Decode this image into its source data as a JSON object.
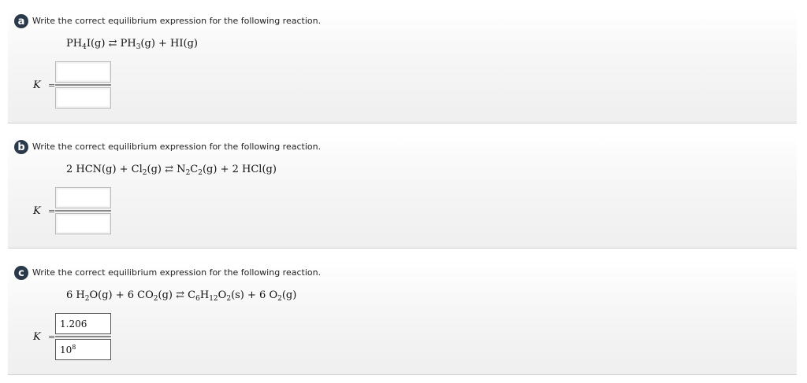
{
  "sections": [
    {
      "badge": "a",
      "prompt": "Write the correct equilibrium expression for the following reaction.",
      "k_label": "K",
      "equals": "=",
      "numerator": "",
      "denominator": ""
    },
    {
      "badge": "b",
      "prompt": "Write the correct equilibrium expression for the following reaction.",
      "k_label": "K",
      "equals": "=",
      "numerator": "",
      "denominator": ""
    },
    {
      "badge": "c",
      "prompt": "Write the correct equilibrium expression for the following reaction.",
      "k_label": "K",
      "equals": "=",
      "numerator": "1.206",
      "denominator_base": "10",
      "denominator_exp": "8"
    }
  ],
  "equations": {
    "a": "PH4I(g) ⇄ PH3(g) + HI(g)",
    "b": "2 HCN(g) + Cl2(g) ⇄ N2C2(g) + 2 HCl(g)",
    "c": "6 H2O(g) + 6 CO2(g) ⇄ C6H12O2(s) + 6 O2(g)"
  }
}
